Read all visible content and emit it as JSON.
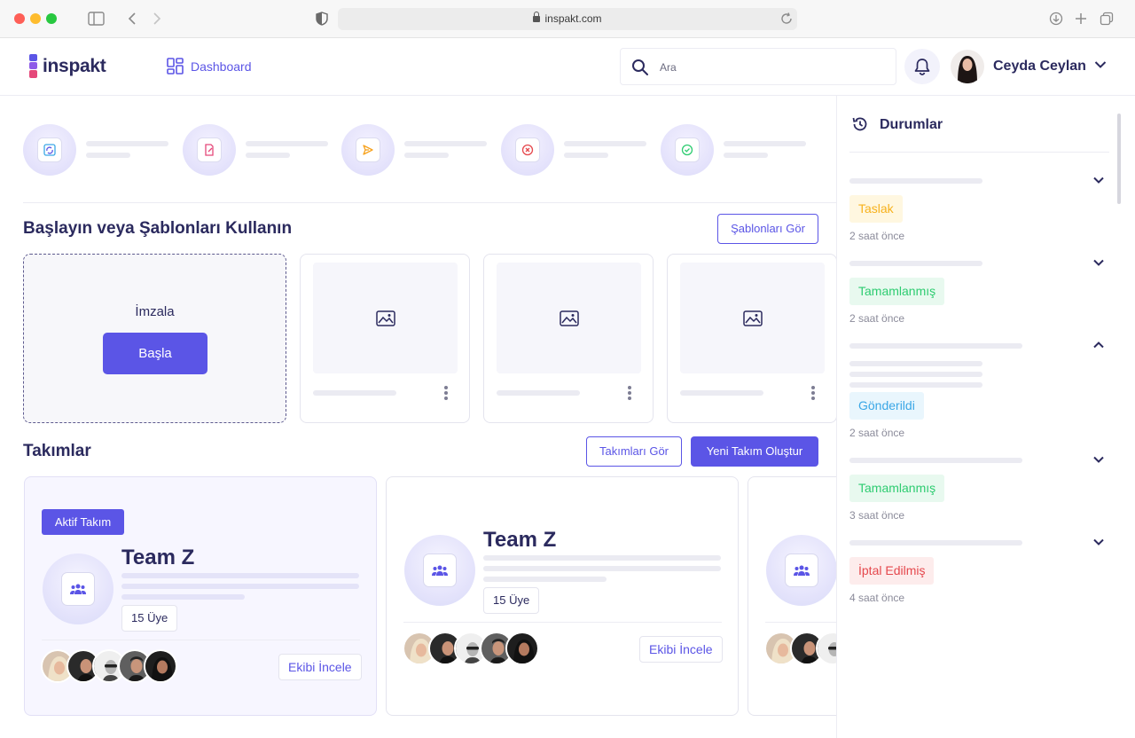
{
  "browser": {
    "url": "inspakt.com"
  },
  "header": {
    "logo_text": "inspakt",
    "nav_dashboard": "Dashboard",
    "search_placeholder": "Ara",
    "user_name": "Ceyda Ceylan"
  },
  "templates_section": {
    "title": "Başlayın veya Şablonları Kullanın",
    "view_templates": "Şablonları Gör",
    "sign_label": "İmzala",
    "start_button": "Başla"
  },
  "teams_section": {
    "title": "Takımlar",
    "view_teams": "Takımları Gör",
    "new_team": "Yeni Takım Oluştur",
    "teams": [
      {
        "active_badge": "Aktif Takım",
        "name": "Team Z",
        "members": "15 Üye",
        "review": "Ekibi İncele"
      },
      {
        "name": "Team Z",
        "members": "15 Üye",
        "review": "Ekibi İncele"
      }
    ]
  },
  "status_panel": {
    "title": "Durumlar",
    "items": [
      {
        "label": "Taslak",
        "time": "2 saat önce",
        "color": "#f7b21d",
        "bg": "#fff7e0",
        "expanded": false
      },
      {
        "label": "Tamamlanmış",
        "time": "2 saat önce",
        "color": "#2ecc71",
        "bg": "#e8f9ef",
        "expanded": false
      },
      {
        "label": "Gönderildi",
        "time": "2 saat önce",
        "color": "#3aa7e6",
        "bg": "#e9f6fd",
        "expanded": true
      },
      {
        "label": "Tamamlanmış",
        "time": "3 saat önce",
        "color": "#2ecc71",
        "bg": "#e8f9ef",
        "expanded": false
      },
      {
        "label": "İptal Edilmiş",
        "time": "4 saat önce",
        "color": "#e5484d",
        "bg": "#fdecec",
        "expanded": false
      }
    ]
  },
  "colors": {
    "accent": "#5b55e6",
    "text_dark": "#2b2a5e"
  },
  "icons": {
    "stats": [
      "sync-document-icon",
      "document-edit-icon",
      "send-icon",
      "cancel-icon",
      "check-icon"
    ]
  }
}
